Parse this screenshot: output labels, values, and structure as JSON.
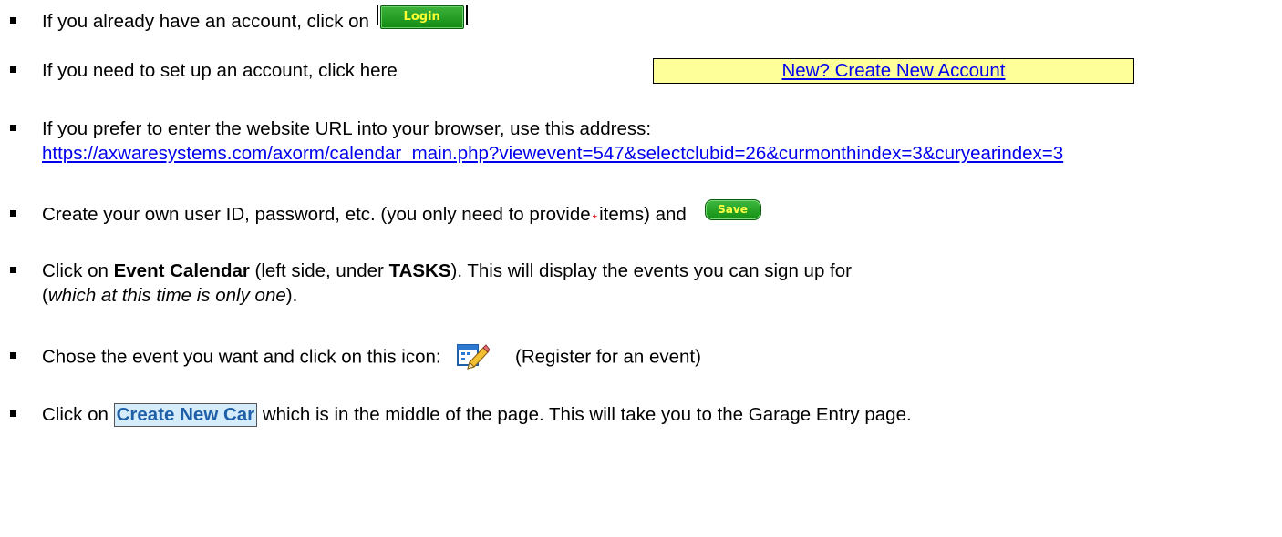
{
  "steps": [
    {
      "text": "If you already have an account, click on",
      "button": "Login"
    },
    {
      "text": "If you need to set up an account, click here",
      "link": "New? Create New Account"
    },
    {
      "text": "If you prefer to enter the website URL into your browser, use this address:",
      "url": "https://axwaresystems.com/axorm/calendar_main.php?viewevent=547&selectclubid=26&curmonthindex=3&curyearindex=3"
    },
    {
      "text_a": "Create your own user ID, password, etc. (you only need to provide",
      "star": "*",
      "text_b": "items) and",
      "button": "Save"
    },
    {
      "text_a": "Click on ",
      "bold_a": "Event Calendar",
      "text_b": " (left side, under ",
      "bold_b": "TASKS",
      "text_c": ").  This will display the events you can sign up for",
      "text_d": "(",
      "italic": "which at this time is only one",
      "text_e": ")."
    },
    {
      "text_a": "Chose the event you want and click on this icon:",
      "icon": "register-event-icon",
      "text_b": "(Register for an event)"
    },
    {
      "text_a": "Click on ",
      "button": "Create New Car",
      "text_b": " which is in the middle of the page.  This will take you to the Garage Entry page."
    }
  ]
}
